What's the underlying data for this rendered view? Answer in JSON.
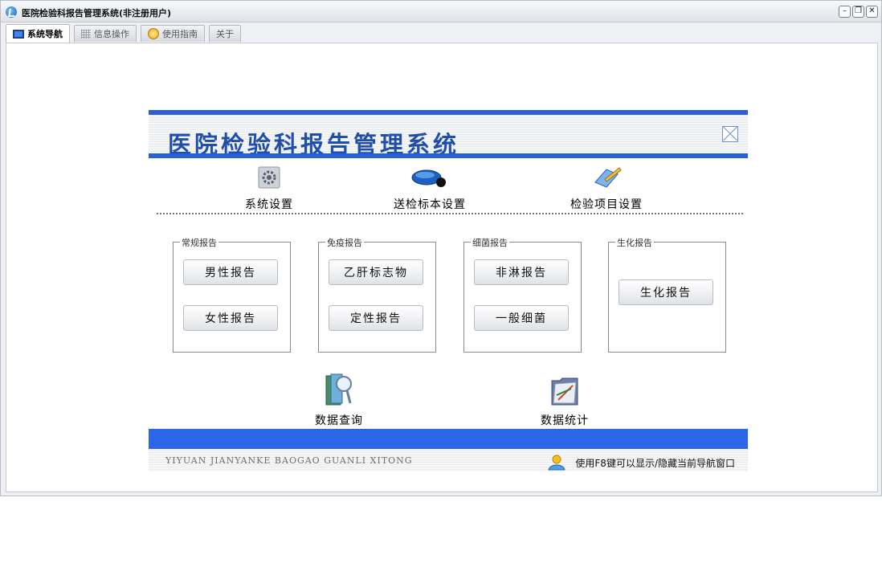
{
  "window": {
    "title": "医院检验科报告管理系统(非注册用户)"
  },
  "tabs": [
    {
      "label": "系统导航",
      "icon": "monitor-icon",
      "active": true
    },
    {
      "label": "信息操作",
      "icon": "grid-icon",
      "active": false
    },
    {
      "label": "使用指南",
      "icon": "help-icon",
      "active": false
    },
    {
      "label": "关于",
      "icon": "",
      "active": false
    }
  ],
  "panel": {
    "title": "医院检验科报告管理系统",
    "top_items": [
      {
        "label": "系统设置",
        "icon": "gear-icon"
      },
      {
        "label": "送检标本设置",
        "icon": "blade-icon"
      },
      {
        "label": "检验项目设置",
        "icon": "edit-book-icon"
      }
    ],
    "groups": [
      {
        "title": "常规报告",
        "buttons": [
          "男性报告",
          "女性报告"
        ]
      },
      {
        "title": "免疫报告",
        "buttons": [
          "乙肝标志物",
          "定性报告"
        ]
      },
      {
        "title": "细菌报告",
        "buttons": [
          "非淋报告",
          "一般细菌"
        ]
      },
      {
        "title": "生化报告",
        "buttons": [
          "生化报告"
        ]
      }
    ],
    "bottom_items": [
      {
        "label": "数据查询",
        "icon": "search-book-icon"
      },
      {
        "label": "数据统计",
        "icon": "folder-chart-icon"
      }
    ],
    "footer_left": "YIYUAN JIANYANKE BAOGAO GUANLI XITONG",
    "footer_right": "使用F8键可以显示/隐藏当前导航窗口"
  },
  "colors": {
    "accent": "#2a5fd8",
    "title_text": "#1f4fa8",
    "footer_bar": "#2c66e8"
  }
}
